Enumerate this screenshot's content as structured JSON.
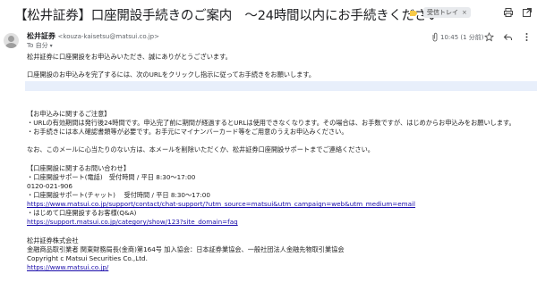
{
  "email": {
    "subject": "【松井証券】口座開設手続きのご案内　〜24時間以内にお手続きください〜",
    "label": "受信トレイ",
    "label_close": "×",
    "sender_name": "松井証券",
    "sender_email": "<kouza-kaisetsu@matsui.co.jp>",
    "recipient": "To 自分",
    "timestamp": "10:45 (1 分前)"
  },
  "body": {
    "greeting": "松井証券に口座開設をお申込みいただき、誠にありがとうございます。",
    "instruction": "口座開設のお申込みを完了するには、次のURLをクリックし指示に従ってお手続きをお願いします。",
    "notes_heading": "【お申込みに関するご注意】",
    "note1": "・URLの有効期間は発行後24時間です。申込完了前に期間が経過するとURLは使用できなくなります。その場合は、お手数ですが、はじめからお申込みをお願いします。",
    "note2": "・お手続きには本人確認書類等が必要です。お手元にマイナンバーカード等をご用意のうえお申込みください。",
    "ignore_note": "なお、このメールに心当たりのない方は、本メールを削除いただくか、松井証券口座開設サポートまでご連絡ください。",
    "contact_heading": "【口座開設に関するお問い合わせ】",
    "phone_line": "・口座開設サポート(電話)　受付時間 / 平日 8:30～17:00",
    "phone_number": "0120-021-906",
    "chat_line": "・口座開設サポート(チャット)　 受付時間 / 平日 8:30～17:00",
    "chat_url": "https://www.matsui.co.jp/support/contact/chat-support/?utm_source=matsui&utm_campaign=web&utm_medium=email",
    "faq_line": "・はじめて口座開設するお客様(Q&A)",
    "faq_url": "https://support.matsui.co.jp/category/show/123?site_domain=faq",
    "company": "松井証券株式会社",
    "registration": "金融商品取引業者 関東財務局長(金商)第164号 加入協会：日本証券業協会、一般社団法人金融先物取引業協会",
    "copyright": "Copyright c Matsui Securities Co.,Ltd.",
    "site_url": "https://www.matsui.co.jp/"
  },
  "icons": {
    "label_icon": "label-arrow-icon",
    "print": "print-icon",
    "open_new": "open-in-new-window-icon",
    "attachment": "paperclip-icon",
    "star": "star-icon",
    "reply": "reply-icon",
    "more": "more-vertical-icon",
    "avatar": "user-avatar-icon"
  }
}
